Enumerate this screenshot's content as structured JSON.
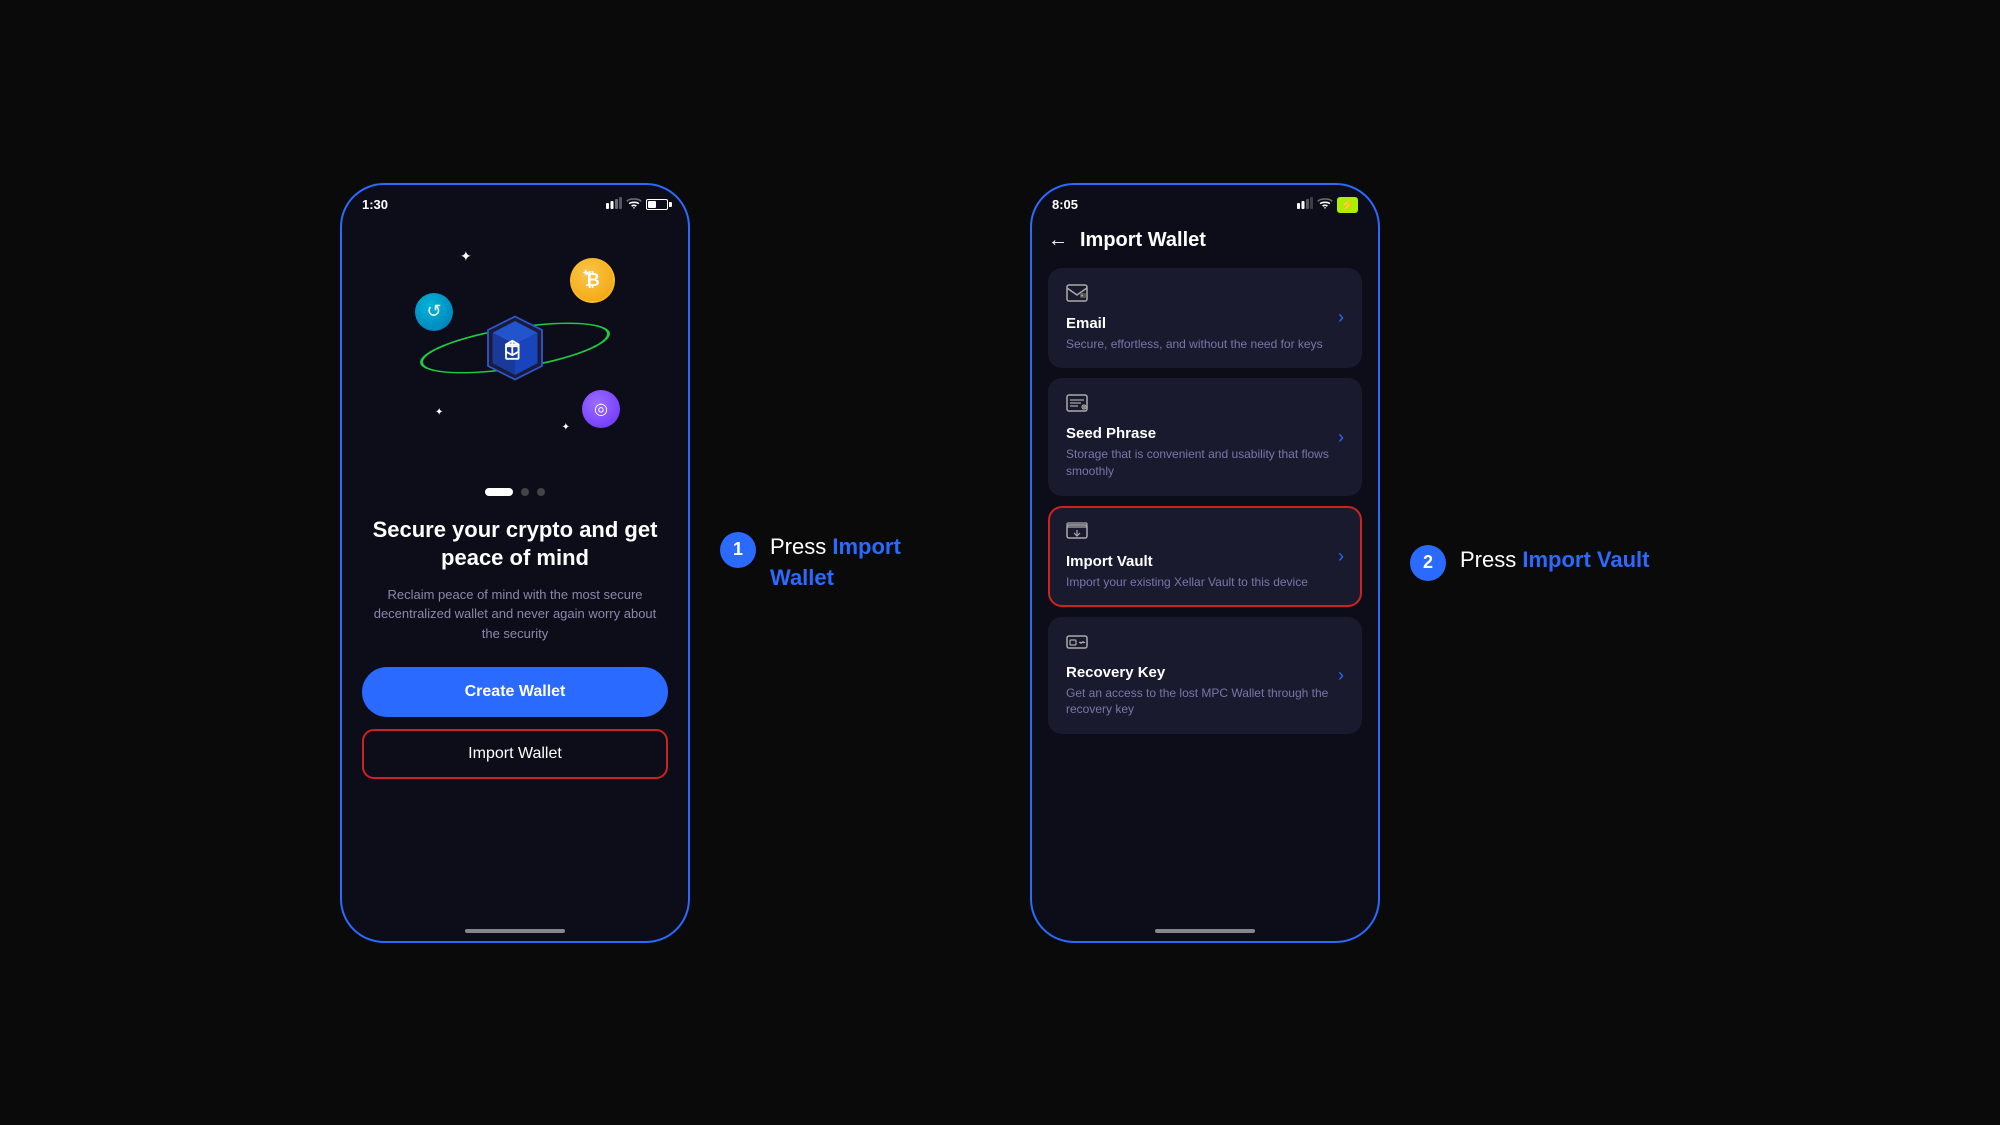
{
  "screen1": {
    "status": {
      "time": "1:30",
      "moon_icon": "🌙",
      "signal": "▐▐▐",
      "wifi": "WiFi",
      "battery": ""
    },
    "hero_alt": "Crypto wallet illustration",
    "dots": [
      {
        "active": true
      },
      {
        "active": false
      },
      {
        "active": false
      }
    ],
    "title": "Secure your crypto and get peace of mind",
    "subtitle": "Reclaim peace of mind with the most secure decentralized wallet and never again worry about the security",
    "create_button": "Create Wallet",
    "import_button": "Import Wallet"
  },
  "step1": {
    "number": "1",
    "instruction_prefix": "Press ",
    "instruction_highlight": "Import Wallet"
  },
  "screen2": {
    "status": {
      "time": "8:05",
      "signal": "▐▐",
      "wifi": "WiFi",
      "battery": "⚡"
    },
    "back_label": "←",
    "title": "Import Wallet",
    "options": [
      {
        "id": "email",
        "icon": "📧",
        "title": "Email",
        "desc": "Secure, effortless, and without the need for keys",
        "highlighted": false
      },
      {
        "id": "seed-phrase",
        "icon": "🗝",
        "title": "Seed Phrase",
        "desc": "Storage that is convenient and usability that flows smoothly",
        "highlighted": false
      },
      {
        "id": "import-vault",
        "icon": "🖥",
        "title": "Import Vault",
        "desc": "Import your existing Xellar Vault to this device",
        "highlighted": true
      },
      {
        "id": "recovery-key",
        "icon": "🔑",
        "title": "Recovery Key",
        "desc": "Get an access to the lost MPC Wallet through the recovery key",
        "highlighted": false
      }
    ]
  },
  "step2": {
    "number": "2",
    "instruction_prefix": "Press ",
    "instruction_highlight": "Import Vault"
  }
}
